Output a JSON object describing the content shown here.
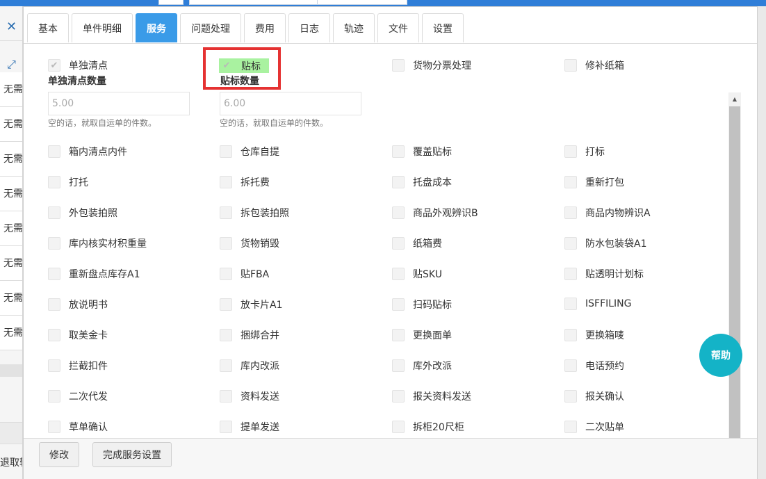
{
  "left_panel": {
    "close_glyph": "✕",
    "expand_glyph": "⤢",
    "rows": [
      "无需",
      "无需",
      "无需",
      "无需",
      "无需",
      "无需",
      "无需",
      "无需"
    ],
    "bottom_text": "退取转"
  },
  "tabs": [
    {
      "label": "基本",
      "active": false
    },
    {
      "label": "单件明细",
      "active": false
    },
    {
      "label": "服务",
      "active": true
    },
    {
      "label": "问题处理",
      "active": false
    },
    {
      "label": "费用",
      "active": false
    },
    {
      "label": "日志",
      "active": false
    },
    {
      "label": "轨迹",
      "active": false
    },
    {
      "label": "文件",
      "active": false
    },
    {
      "label": "设置",
      "active": false
    }
  ],
  "service": {
    "separate_count": {
      "option": "单独清点",
      "qty_label": "单独清点数量",
      "qty_value": "5.00",
      "qty_help": "空的话，就取自运单的件数。"
    },
    "labeling": {
      "option": "贴标",
      "qty_label": "贴标数量",
      "qty_value": "6.00",
      "qty_help": "空的话，就取自运单的件数。"
    },
    "cargo_invoice": "货物分票处理",
    "repair_box": "修补纸箱",
    "grid_options": [
      [
        "箱内清点内件",
        "仓库自提",
        "覆盖贴标",
        "打标"
      ],
      [
        "打托",
        "拆托费",
        "托盘成本",
        "重新打包"
      ],
      [
        "外包装拍照",
        "拆包装拍照",
        "商品外观辨识B",
        "商品内物辨识A"
      ],
      [
        "库内核实材积重量",
        "货物销毁",
        "纸箱费",
        "防水包装袋A1"
      ],
      [
        "重新盘点库存A1",
        "贴FBA",
        "贴SKU",
        "贴透明计划标"
      ],
      [
        "放说明书",
        "放卡片A1",
        "扫码贴标",
        "ISFFILING"
      ],
      [
        "取美金卡",
        "捆绑合并",
        "更换面单",
        "更换箱唛"
      ],
      [
        "拦截扣件",
        "库内改派",
        "库外改派",
        "电话预约"
      ],
      [
        "二次代发",
        "资料发送",
        "报关资料发送",
        "报关确认"
      ],
      [
        "草单确认",
        "提单发送",
        "拆柜20尺柜",
        "二次贴单"
      ]
    ]
  },
  "help_label": "帮助",
  "footer": {
    "modify_label": "修改",
    "complete_label": "完成服务设置"
  },
  "check_glyph": "✔",
  "colors": {
    "tab_active": "#3a9be8",
    "highlight": "#a9f2a0",
    "red_box": "#e53232",
    "help_circle": "#14b3c7",
    "top_strip": "#2f7ed8"
  }
}
